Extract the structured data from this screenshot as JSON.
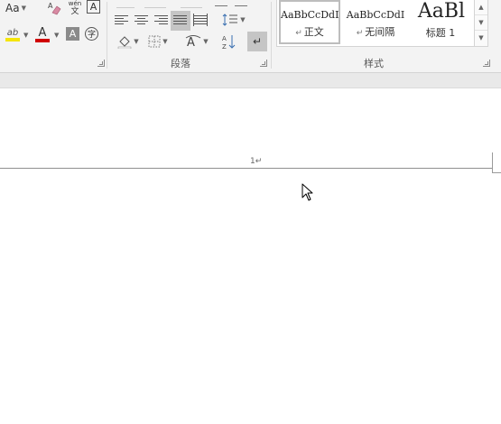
{
  "ribbon": {
    "font_group": {
      "change_case_label": "Aa",
      "phonetic_top": "wén",
      "phonetic_bottom": "文",
      "char_border_label": "A",
      "enclose_char_label": "字",
      "font_color_label": "A",
      "char_shading_label": "A"
    },
    "paragraph_group": {
      "label": "段落"
    },
    "styles_group": {
      "label": "样式",
      "tiles": [
        {
          "sample": "AaBbCcDdI",
          "name": "正文",
          "mark": "↵",
          "selected": true
        },
        {
          "sample": "AaBbCcDdI",
          "name": "无间隔",
          "mark": "↵",
          "selected": false
        },
        {
          "sample": "AaBl",
          "name": "标题 1",
          "mark": "",
          "selected": false
        }
      ]
    }
  },
  "document": {
    "page_number": "1↵"
  },
  "colors": {
    "ribbon_bg": "#f3f3f3",
    "selected_button": "#c5c5c5",
    "highlight_yellow": "#f5e50a",
    "font_color_red": "#d00000"
  }
}
